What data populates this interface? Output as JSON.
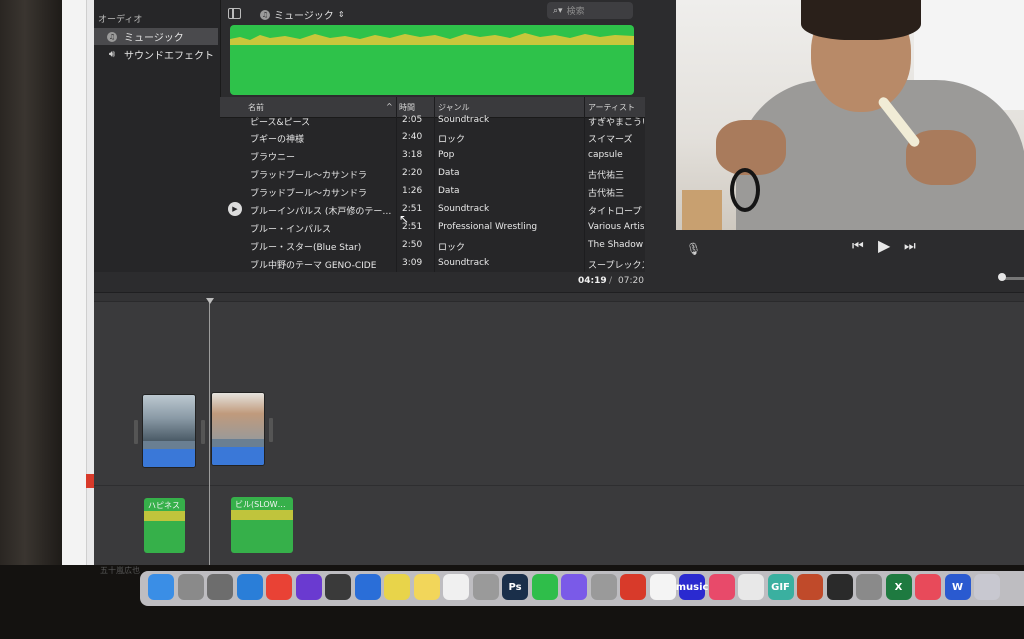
{
  "sidebar": {
    "header": "オーディオ",
    "items": [
      {
        "label": "ミュージック",
        "icon": "music-note-icon",
        "selected": true
      },
      {
        "label": "サウンドエフェクト",
        "icon": "speaker-icon",
        "selected": false
      }
    ]
  },
  "browser": {
    "library_label": "ミュージック",
    "search_placeholder": "検索"
  },
  "table": {
    "headers": {
      "name": "名前",
      "time": "時間",
      "genre": "ジャンル",
      "artist": "アーティスト"
    },
    "rows": [
      {
        "name": "ピース&ピース",
        "time": "2:05",
        "genre": "Soundtrack",
        "artist": "すぎやまこうい"
      },
      {
        "name": "ブギーの神様",
        "time": "2:40",
        "genre": "ロック",
        "artist": "スイマーズ"
      },
      {
        "name": "ブラウニー",
        "time": "3:18",
        "genre": "Pop",
        "artist": "capsule"
      },
      {
        "name": "ブラッドブール〜カサンドラ",
        "time": "2:20",
        "genre": "Data",
        "artist": "古代祐三"
      },
      {
        "name": "ブラッドブール〜カサンドラ",
        "time": "1:26",
        "genre": "Data",
        "artist": "古代祐三"
      },
      {
        "name": "ブルーインパルス (木戸修のテー…",
        "time": "2:51",
        "genre": "Soundtrack",
        "artist": "タイトロープ",
        "playing": true
      },
      {
        "name": "ブルー・インパルス",
        "time": "2:51",
        "genre": "Professional Wrestling",
        "artist": "Various Artis"
      },
      {
        "name": "ブルー・スター(Blue Star)",
        "time": "2:50",
        "genre": "ロック",
        "artist": "The Shadow"
      },
      {
        "name": "ブル中野のテーマ GENO-CIDE",
        "time": "3:09",
        "genre": "Soundtrack",
        "artist": "スープレックス"
      }
    ]
  },
  "timecode": {
    "current": "04:19",
    "separator": "/",
    "total": "07:20"
  },
  "timeline": {
    "music_clips": [
      {
        "label": "ハピネス"
      },
      {
        "label": "ビル(SLOW…"
      }
    ]
  },
  "desktop_label": "五十嵐広也",
  "dock": {
    "items": [
      {
        "icon": "finder-icon",
        "color": "#3a8ee6"
      },
      {
        "icon": "launchpad-icon",
        "color": "#8a8a8a"
      },
      {
        "icon": "preview-icon",
        "color": "#6d6d6d"
      },
      {
        "icon": "safari-icon",
        "color": "#2a7ed8"
      },
      {
        "icon": "chrome-icon",
        "color": "#e94235"
      },
      {
        "icon": "imovie-icon",
        "color": "#6a3ad0"
      },
      {
        "icon": "final-cut-icon",
        "color": "#3a3a3a"
      },
      {
        "icon": "quicktime-icon",
        "color": "#2a6ed8"
      },
      {
        "icon": "stickies-icon",
        "color": "#e8d44a"
      },
      {
        "icon": "notes-icon",
        "color": "#f2d65a"
      },
      {
        "icon": "textedit-icon",
        "color": "#f0f0f0"
      },
      {
        "icon": "creative-cloud-icon",
        "color": "#9a9a9a"
      },
      {
        "icon": "photoshop-icon",
        "color": "#1a2f4a",
        "text": "Ps"
      },
      {
        "icon": "line-icon",
        "color": "#2fbe4a"
      },
      {
        "icon": "messenger-icon",
        "color": "#7a5ae8"
      },
      {
        "icon": "printer-icon",
        "color": "#9a9a9a"
      },
      {
        "icon": "photo-booth-icon",
        "color": "#d83a2a"
      },
      {
        "icon": "calendar-icon",
        "color": "#f4f4f4"
      },
      {
        "icon": "amazon-music-icon",
        "color": "#2a2ad0",
        "text": "music"
      },
      {
        "icon": "itunes-icon",
        "color": "#e84a6a"
      },
      {
        "icon": "photos-icon",
        "color": "#e8e8e8"
      },
      {
        "icon": "gif-icon",
        "color": "#3ab0a0",
        "text": "GIF"
      },
      {
        "icon": "photo-app-icon",
        "color": "#c04a2a"
      },
      {
        "icon": "activity-monitor-icon",
        "color": "#2a2a2a"
      },
      {
        "icon": "system-preferences-icon",
        "color": "#8a8a8a"
      },
      {
        "icon": "excel-icon",
        "color": "#1e7a40",
        "text": "X"
      },
      {
        "icon": "adobe-cc-icon",
        "color": "#e84a5a"
      },
      {
        "icon": "word-icon",
        "color": "#2a5ad0",
        "text": "W"
      },
      {
        "icon": "screenshot-icon",
        "color": "#c8c8d0"
      }
    ]
  },
  "colors": {
    "app_bg": "#2c2c2e",
    "waveform": "#2ec24a",
    "video_clip_audio": "#3a78d8",
    "music_clip": "#36b04a"
  }
}
